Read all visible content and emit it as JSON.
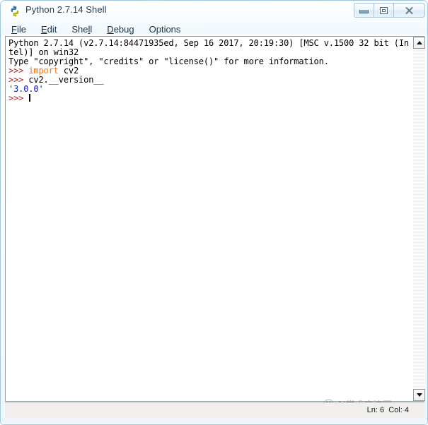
{
  "window": {
    "title": "Python 2.7.14 Shell",
    "icon": "python-idle-icon",
    "controls": [
      {
        "name": "minimize-button",
        "glyph": "minimize-icon",
        "label": "Minimize"
      },
      {
        "name": "maximize-button",
        "glyph": "maximize-icon",
        "label": "Maximize"
      },
      {
        "name": "close-button",
        "glyph": "close-icon",
        "label": "Close"
      }
    ]
  },
  "menu": {
    "items": [
      {
        "label": "File",
        "mnemonic": "F"
      },
      {
        "label": "Edit",
        "mnemonic": "E"
      },
      {
        "label": "Shell",
        "mnemonic": "l"
      },
      {
        "label": "Debug",
        "mnemonic": "D"
      },
      {
        "label": "Options",
        "mnemonic": ""
      }
    ]
  },
  "shell": {
    "lines": [
      {
        "id": "banner-1",
        "text": "Python 2.7.14 (v2.7.14:84471935ed, Sep 16 2017, 20:19:30) [MSC v.1500 32 bit (In"
      },
      {
        "id": "banner-2",
        "text": "tel)] on win32"
      },
      {
        "id": "banner-3",
        "text": "Type \"copyright\", \"credits\" or \"license()\" for more information."
      },
      {
        "id": "input-1-prompt",
        "text": ">>> "
      },
      {
        "id": "input-1-keyword",
        "text": "import"
      },
      {
        "id": "input-1-rest",
        "text": " cv2"
      },
      {
        "id": "input-2-prompt",
        "text": ">>> "
      },
      {
        "id": "input-2-rest",
        "text": "cv2.__version__"
      },
      {
        "id": "output-1",
        "text": "'3.0.0'"
      },
      {
        "id": "input-3-prompt",
        "text": ">>> "
      }
    ],
    "colors": {
      "prompt": "#b32222",
      "keyword": "#ff7700",
      "output_string": "#1111cc",
      "normal": "#000000",
      "background": "#ffffff"
    }
  },
  "scrollbar": {
    "up_arrow": "scroll-up-arrow-icon",
    "down_arrow": "scroll-down-arrow-icon"
  },
  "status": {
    "text": "Ln: 6  Col: 4",
    "line": "6",
    "column": "4"
  },
  "watermark": {
    "text": "AI学术交流圈"
  }
}
